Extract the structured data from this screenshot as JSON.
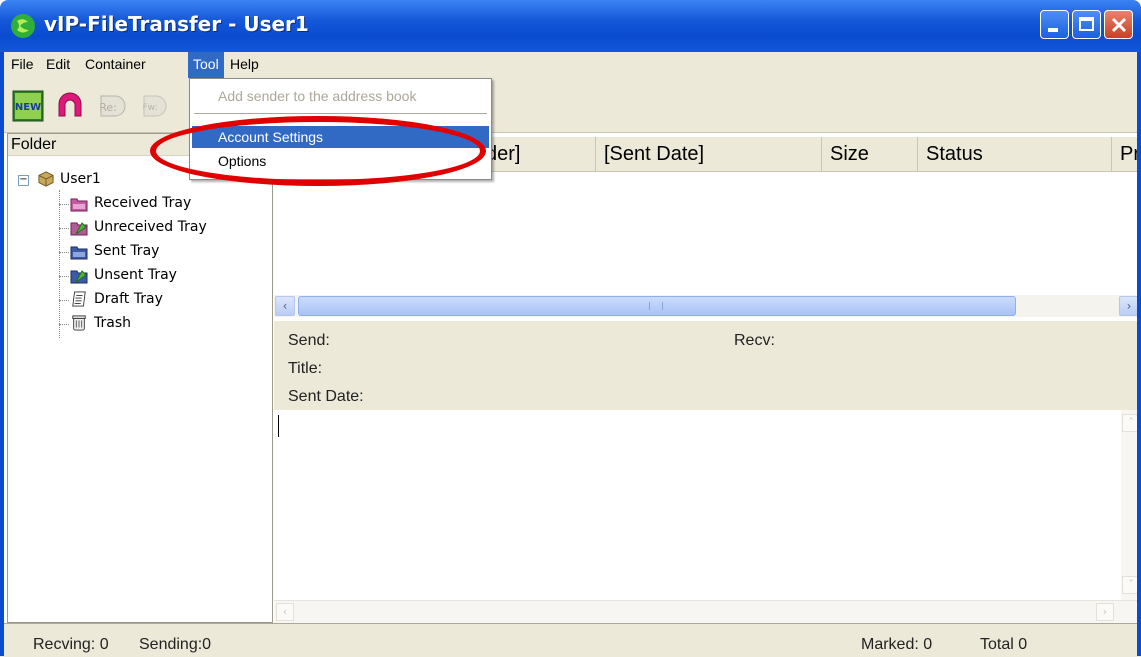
{
  "window": {
    "title": "vIP-FileTransfer - User1",
    "colors": {
      "titlebar": "#0a4bd0",
      "menu_highlight": "#316ac5",
      "annotation": "#e00000"
    }
  },
  "menubar": {
    "items": [
      {
        "label": "File"
      },
      {
        "label": "Edit"
      },
      {
        "label": "Container"
      },
      {
        "label": "Tool"
      },
      {
        "label": "Help"
      }
    ],
    "active": "Tool"
  },
  "toolbar": {
    "buttons": [
      {
        "icon": "new-icon",
        "label": "NEW"
      },
      {
        "icon": "refresh-icon"
      },
      {
        "icon": "reply-icon",
        "label": "Re:"
      },
      {
        "icon": "forward-icon",
        "label": "Fw:"
      }
    ]
  },
  "dropdown": {
    "items": [
      {
        "label": "Add sender to the address book",
        "state": "disabled"
      },
      {
        "label": "Account Settings",
        "state": "selected"
      },
      {
        "label": "Options",
        "state": "normal"
      }
    ]
  },
  "folder_pane": {
    "header": "Folder",
    "root": {
      "label": "User1",
      "icon": "package-icon",
      "expander": "minus"
    },
    "items": [
      {
        "label": "Received Tray",
        "icon": "received-tray-icon"
      },
      {
        "label": "Unreceived Tray",
        "icon": "unreceived-tray-icon"
      },
      {
        "label": "Sent Tray",
        "icon": "sent-tray-icon"
      },
      {
        "label": "Unsent Tray",
        "icon": "unsent-tray-icon"
      },
      {
        "label": "Draft Tray",
        "icon": "draft-tray-icon"
      },
      {
        "label": "Trash",
        "icon": "trash-icon"
      }
    ]
  },
  "list": {
    "columns": [
      {
        "label": "der]"
      },
      {
        "label": "[Sent Date]"
      },
      {
        "label": "Size"
      },
      {
        "label": "Status"
      },
      {
        "label": "Pr"
      }
    ]
  },
  "info": {
    "send_label": "Send:",
    "recv_label": "Recv:",
    "title_label": "Title:",
    "sent_date_label": "Sent Date:"
  },
  "status": {
    "recving": "Recving: 0",
    "sending": "Sending:0",
    "marked": "Marked:  0",
    "total": "Total   0"
  }
}
